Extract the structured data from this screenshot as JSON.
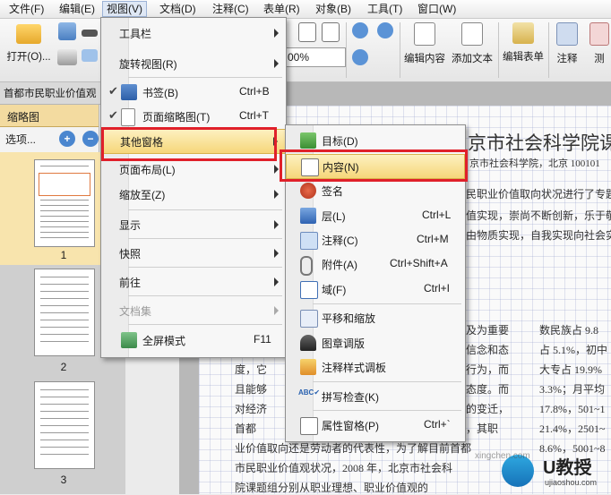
{
  "menubar": [
    "文件(F)",
    "编辑(E)",
    "视图(V)",
    "文档(D)",
    "注释(C)",
    "表单(R)",
    "对象(B)",
    "工具(T)",
    "窗口(W)"
  ],
  "toolbar": {
    "open_label": "打开(O)...",
    "zoom_value": "00%",
    "edit_content": "编辑内容",
    "add_text": "添加文本",
    "edit_form": "编辑表单",
    "comment": "注释",
    "measure": "测"
  },
  "doc_tab": "首都市民职业价值观",
  "left_pane": {
    "title": "缩略图",
    "options": "选项...",
    "pages": [
      "1",
      "2",
      "3"
    ]
  },
  "document": {
    "title": "京市社会科学院课题",
    "subtitle": "京市社会科学院，北京 100101",
    "lines": [
      "民职业价值取向状况进行了专题",
      "值实现，崇尚不断创新，乐于敬",
      "由物质实现，自我实现向社会实",
      "及为重要",
      "信念和态",
      "行为，而",
      "态度。而",
      "的变迁，",
      "，其职",
      "度，它",
      "且能够",
      "对经济",
      "首都",
      "业价值取向还是劳动者的代表性，为了解目前首都",
      "市民职业价值观状况，2008 年，北京市社会科",
      "院课题组分别从职业理想、职业价值观的"
    ],
    "right_col": [
      "数民族占 9.8",
      "占 5.1%，初中",
      "大专占 19.9%",
      "3.3%；月平均",
      "17.8%，501~1",
      "21.4%，2501~",
      "8.6%，5001~8"
    ]
  },
  "view_menu": {
    "items": [
      {
        "label": "工具栏",
        "shortcut": "",
        "submenu": true
      },
      {
        "label": "旋转视图(R)",
        "shortcut": "",
        "submenu": true
      },
      {
        "label": "书签(B)",
        "shortcut": "Ctrl+B",
        "checked": true
      },
      {
        "label": "页面缩略图(T)",
        "shortcut": "Ctrl+T",
        "checked": true
      },
      {
        "label": "其他窗格",
        "shortcut": "",
        "submenu": true,
        "highlighted": true
      },
      {
        "label": "页面布局(L)",
        "shortcut": "",
        "submenu": true
      },
      {
        "label": "缩放至(Z)",
        "shortcut": "",
        "submenu": true
      },
      {
        "label": "显示",
        "shortcut": "",
        "submenu": true
      },
      {
        "label": "快照",
        "shortcut": "",
        "submenu": true
      },
      {
        "label": "前往",
        "shortcut": "",
        "submenu": true
      },
      {
        "label": "文档集",
        "shortcut": "",
        "submenu": true,
        "disabled": true
      },
      {
        "label": "全屏模式",
        "shortcut": "F11"
      }
    ]
  },
  "pane_submenu": {
    "items": [
      {
        "label": "目标(D)",
        "shortcut": ""
      },
      {
        "label": "内容(N)",
        "shortcut": "",
        "highlighted": true
      },
      {
        "label": "签名",
        "shortcut": ""
      },
      {
        "label": "层(L)",
        "shortcut": "Ctrl+L"
      },
      {
        "label": "注释(C)",
        "shortcut": "Ctrl+M"
      },
      {
        "label": "附件(A)",
        "shortcut": "Ctrl+Shift+A"
      },
      {
        "label": "域(F)",
        "shortcut": "Ctrl+I"
      },
      {
        "label": "平移和缩放",
        "shortcut": ""
      },
      {
        "label": "图章调版",
        "shortcut": ""
      },
      {
        "label": "注释样式调板",
        "shortcut": ""
      },
      {
        "label": "拼写检查(K)",
        "shortcut": ""
      },
      {
        "label": "属性窗格(P)",
        "shortcut": "Ctrl+`"
      }
    ]
  },
  "watermark": {
    "brand": "U教授",
    "url": "ujiaoshou.com",
    "ghost": "xingchen.com"
  },
  "colors": {
    "highlight": "#f6d77a",
    "red_box": "#e0202a"
  }
}
